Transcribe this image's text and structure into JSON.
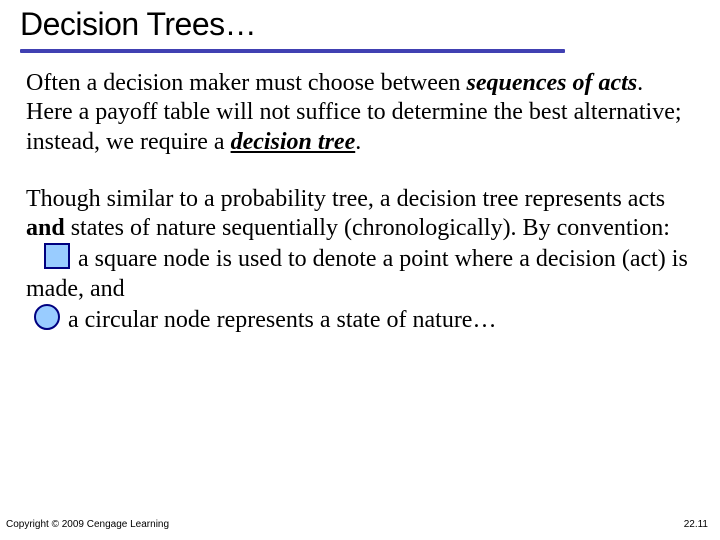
{
  "title": "Decision Trees…",
  "p1": {
    "t1": "Often a decision maker must choose between ",
    "seq": "sequences of acts",
    "t2": ". Here a payoff table will not suffice to determine the best alternative; instead, we require a ",
    "dtree": "decision tree",
    "t3": "."
  },
  "p2": {
    "t1": "Though similar to a probability tree, a decision tree represents acts ",
    "and": "and",
    "t2": " states of nature sequentially (chronologically). By convention:",
    "sq": " a square node is used to denote a point where a decision (act) is made, and",
    "ci": " a circular node represents a state of nature…"
  },
  "footer": {
    "copyright": "Copyright © 2009 Cengage Learning",
    "page": "22.11"
  }
}
